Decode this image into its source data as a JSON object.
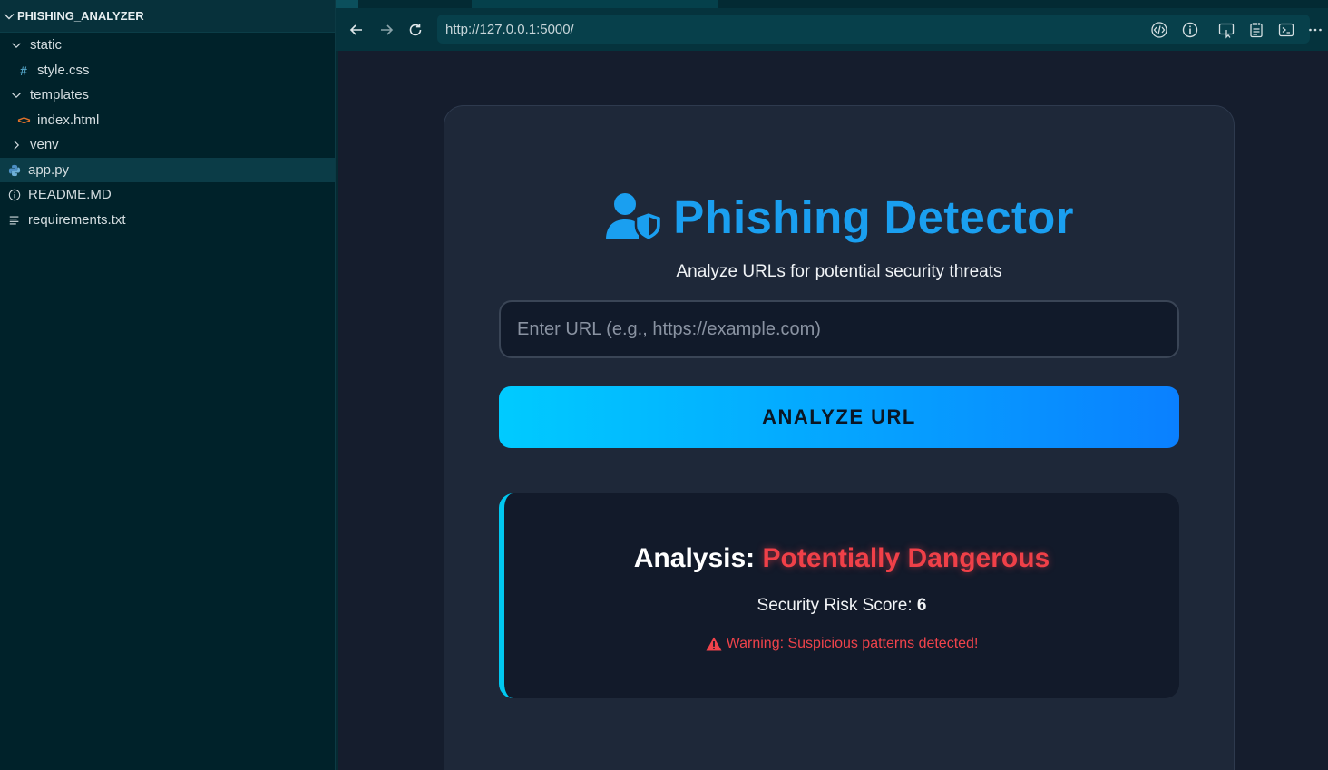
{
  "explorer": {
    "project": "PHISHING_ANALYZER",
    "items": [
      {
        "label": "static",
        "kind": "folder-open",
        "depth": 0,
        "icon": "chevron-down-icon"
      },
      {
        "label": "style.css",
        "kind": "file",
        "depth": 1,
        "icon": "css-hash-icon"
      },
      {
        "label": "templates",
        "kind": "folder-open",
        "depth": 0,
        "icon": "chevron-down-icon"
      },
      {
        "label": "index.html",
        "kind": "file",
        "depth": 1,
        "icon": "html-code-icon"
      },
      {
        "label": "venv",
        "kind": "folder-closed",
        "depth": 0,
        "icon": "chevron-right-icon"
      },
      {
        "label": "app.py",
        "kind": "file",
        "depth": 0,
        "icon": "python-icon",
        "selected": true
      },
      {
        "label": "README.MD",
        "kind": "file",
        "depth": 0,
        "icon": "info-icon"
      },
      {
        "label": "requirements.txt",
        "kind": "file",
        "depth": 0,
        "icon": "lines-icon"
      }
    ]
  },
  "browser": {
    "url": "http://127.0.0.1:5000/"
  },
  "app": {
    "title": "Phishing Detector",
    "subtitle": "Analyze URLs for potential security threats",
    "input_placeholder": "Enter URL (e.g., https://example.com)",
    "input_value": "",
    "button_label": "ANALYZE URL",
    "result": {
      "heading_prefix": "Analysis:",
      "verdict": "Potentially Dangerous",
      "risk_label": "Security Risk Score:",
      "risk_score": "6",
      "warning": "Warning: Suspicious patterns detected!"
    }
  },
  "colors": {
    "accent": "#1a9ff0",
    "danger": "#f04048",
    "button_gradient_start": "#00cbff",
    "button_gradient_end": "#0a80ff",
    "result_border": "#00c8f0"
  }
}
